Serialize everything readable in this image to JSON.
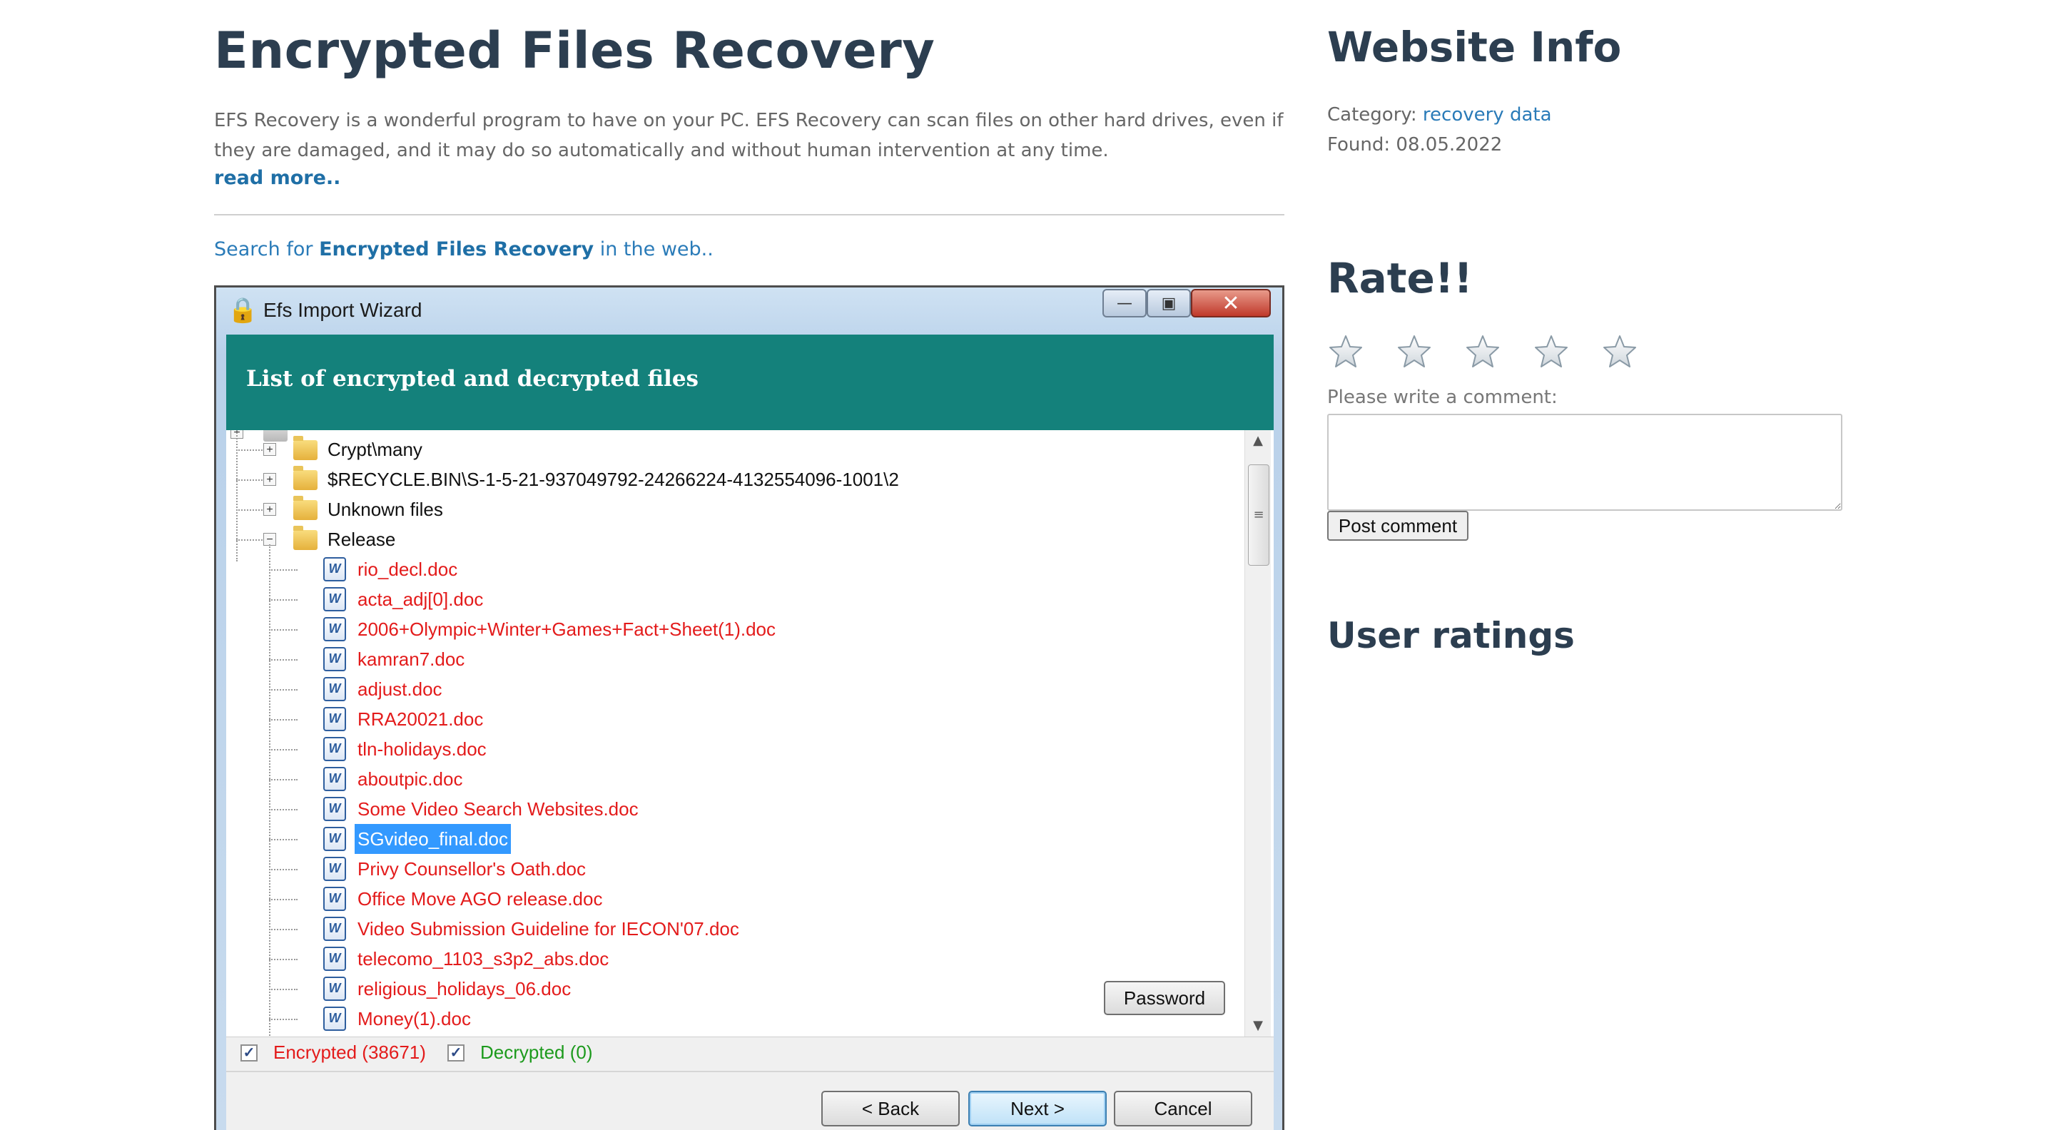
{
  "article": {
    "title": "Encrypted Files Recovery",
    "description": "EFS Recovery is a wonderful program to have on your PC. EFS Recovery can scan files on other hard drives, even if they are damaged, and it may do so automatically and without human intervention at any time.",
    "read_more": "read more..",
    "search_prefix": "Search for ",
    "search_term": "Encrypted Files Recovery",
    "search_suffix": " in the web.."
  },
  "screenshot": {
    "window_title": "Efs Import Wizard",
    "header": "List of encrypted and decrypted files",
    "tree": {
      "folders": [
        "Crypt\\many",
        "$RECYCLE.BIN\\S-1-5-21-937049792-24266224-4132554096-1001\\2",
        "Unknown files",
        "Release"
      ],
      "files": [
        "rio_decl.doc",
        "acta_adj[0].doc",
        "2006+Olympic+Winter+Games+Fact+Sheet(1).doc",
        "kamran7.doc",
        "adjust.doc",
        "RRA20021.doc",
        "tln-holidays.doc",
        "aboutpic.doc",
        "Some Video Search Websites.doc",
        "SGvideo_final.doc",
        "Privy Counsellor's Oath.doc",
        "Office Move AGO release.doc",
        "Video Submission Guideline for IECON'07.doc",
        "telecomo_1103_s3p2_abs.doc",
        "religious_holidays_06.doc",
        "Money(1).doc"
      ],
      "selected_file": "SGvideo_final.doc"
    },
    "password_button": "Password",
    "legend": {
      "encrypted": "Encrypted (38671)",
      "decrypted": "Decrypted (0)"
    },
    "buttons": {
      "back": "< Back",
      "next": "Next >",
      "cancel": "Cancel"
    },
    "colors": {
      "header_bg": "#14817b",
      "encrypted": "#e31b1b",
      "decrypted": "#1c9a1c",
      "selection": "#3399ff"
    }
  },
  "sidebar": {
    "website_info_title": "Website Info",
    "category_label": "Category: ",
    "category_value": "recovery data",
    "found_label": "Found: ",
    "found_value": "08.05.2022",
    "rate_title": "Rate!!",
    "stars_total": 5,
    "stars_filled": 0,
    "comment_label": "Please write a comment:",
    "post_button": "Post comment",
    "user_ratings_title": "User ratings"
  }
}
